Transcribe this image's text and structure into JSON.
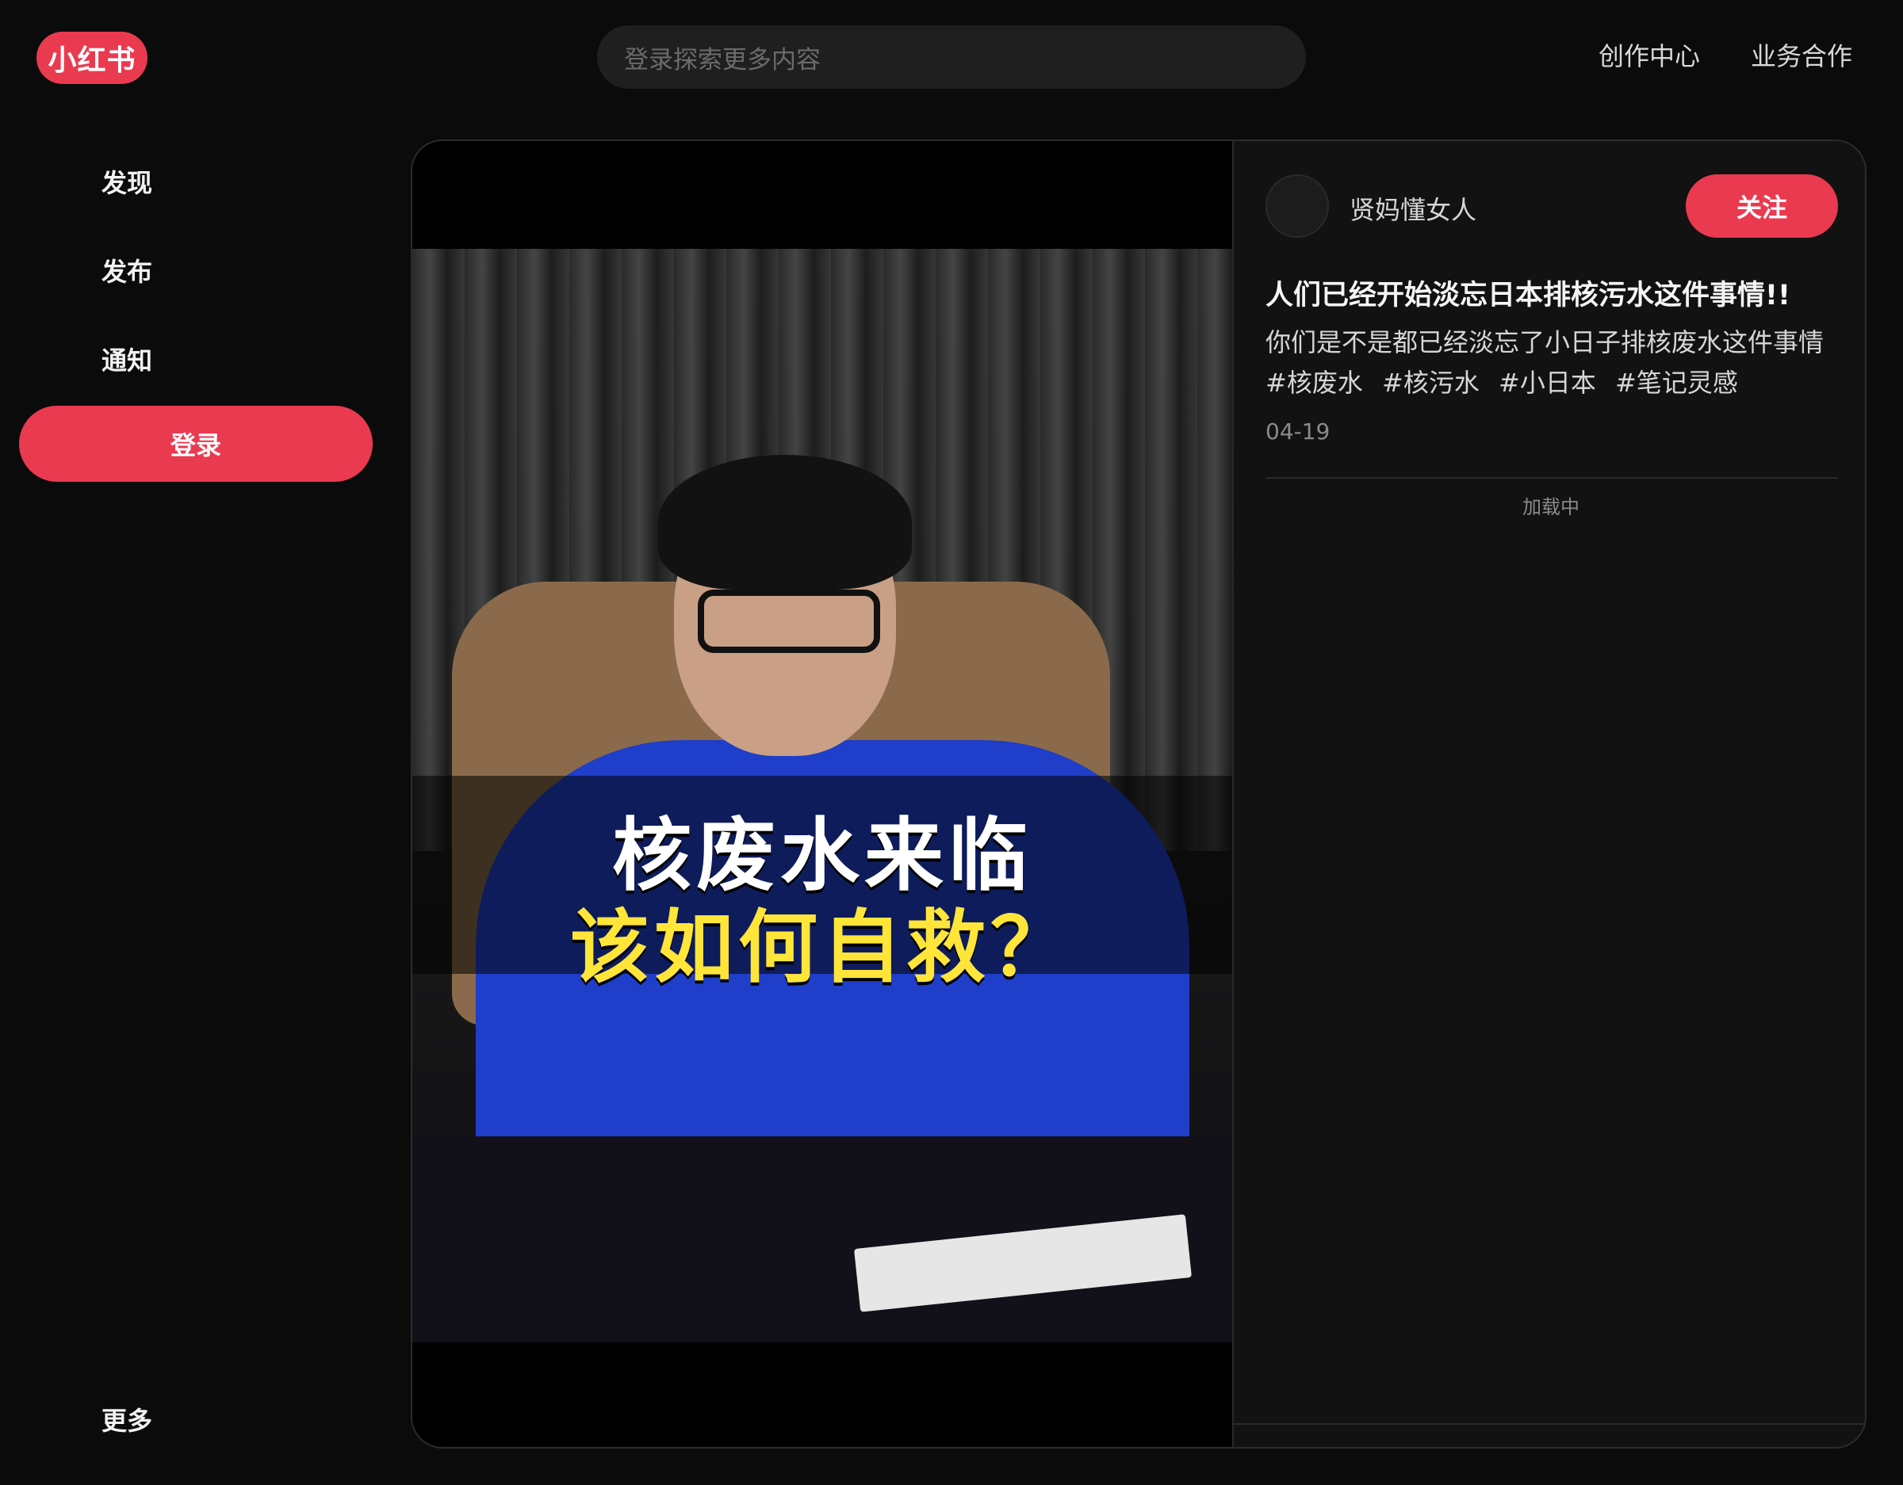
{
  "brand": {
    "logo_text": "小红书"
  },
  "search": {
    "placeholder": "登录探索更多内容"
  },
  "topnav": {
    "creator_center": "创作中心",
    "business": "业务合作"
  },
  "sidebar": {
    "items": [
      {
        "label": "发现"
      },
      {
        "label": "发布"
      },
      {
        "label": "通知"
      }
    ],
    "login_label": "登录",
    "more_label": "更多"
  },
  "video": {
    "caption_line1": "核废水来临",
    "caption_line2": "该如何自救？",
    "caption_color_1": "#ffffff",
    "caption_color_2": "#ffe53a"
  },
  "post": {
    "author": "贤妈懂女人",
    "follow_label": "关注",
    "title": "人们已经开始淡忘日本排核污水这件事情!!",
    "description": "你们是不是都已经淡忘了小日子排核废水这件事情",
    "tags": [
      "#核废水",
      "#核污水",
      "#小日本",
      "#笔记灵感"
    ],
    "date": "04-19",
    "loading_text": "加载中"
  },
  "colors": {
    "accent": "#ea3a50",
    "background": "#0b0b0b",
    "panel": "#121212"
  }
}
